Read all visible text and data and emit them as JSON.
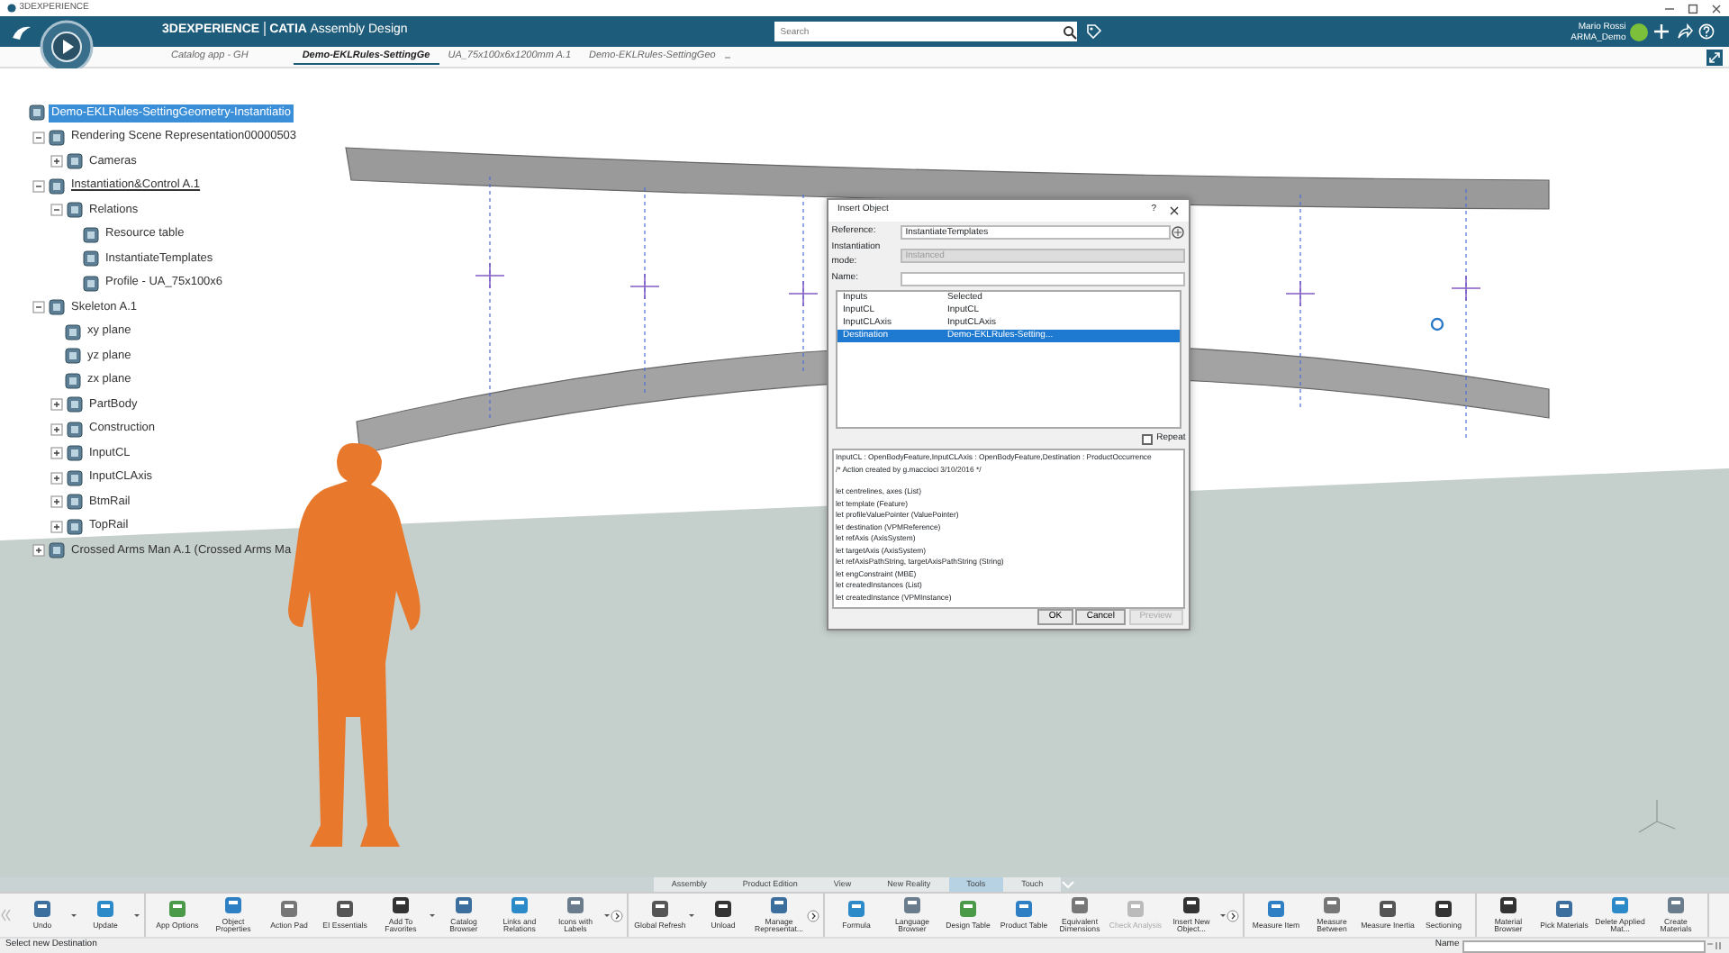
{
  "window": {
    "title": "3DEXPERIENCE"
  },
  "header": {
    "brand": "3DEXPERIENCE",
    "product": "CATIA",
    "app": "Assembly Design",
    "search": {
      "placeholder": "Search"
    },
    "user": {
      "name": "Mario Rossi",
      "workspace": "ARMA_Demo"
    }
  },
  "document_tabs": [
    {
      "label": "Catalog app - GH",
      "selected": false
    },
    {
      "label": "Demo-EKLRules-SettingGe",
      "selected": true
    },
    {
      "label": "UA_75x100x6x1200mm A.1",
      "selected": false
    },
    {
      "label": "Demo-EKLRules-SettingGeo",
      "selected": false
    }
  ],
  "tree": {
    "label": "Demo-EKLRules-SettingGeometry-Instantiatio",
    "selected": true,
    "active": false,
    "children": [
      {
        "label": "Rendering Scene Representation00000503",
        "expanded": true,
        "selected": false,
        "active": false,
        "children": [
          {
            "label": "Cameras",
            "expanded": false,
            "selected": false,
            "active": false
          }
        ]
      },
      {
        "label": "Instantiation&Control A.1",
        "expanded": true,
        "selected": false,
        "active": true,
        "children": [
          {
            "label": "Relations",
            "expanded": true,
            "selected": false,
            "active": false,
            "children": [
              {
                "label": "Resource table",
                "selected": false,
                "active": false
              },
              {
                "label": "InstantiateTemplates",
                "selected": false,
                "active": false
              },
              {
                "label": "Profile - UA_75x100x6",
                "selected": false,
                "active": false
              }
            ]
          }
        ]
      },
      {
        "label": "Skeleton A.1",
        "expanded": true,
        "selected": false,
        "active": false,
        "children": [
          {
            "label": "xy plane",
            "selected": false,
            "active": false
          },
          {
            "label": "yz plane",
            "selected": false,
            "active": false
          },
          {
            "label": "zx plane",
            "selected": false,
            "active": false
          },
          {
            "label": "PartBody",
            "expanded": false,
            "selected": false,
            "active": false
          },
          {
            "label": "Construction",
            "expanded": false,
            "selected": false,
            "active": false
          },
          {
            "label": "InputCL",
            "expanded": false,
            "selected": false,
            "active": false
          },
          {
            "label": "InputCLAxis",
            "expanded": false,
            "selected": false,
            "active": false
          },
          {
            "label": "BtmRail",
            "expanded": false,
            "selected": false,
            "active": false
          },
          {
            "label": "TopRail",
            "expanded": false,
            "selected": false,
            "active": false
          }
        ]
      },
      {
        "label": "Crossed Arms Man A.1 (Crossed Arms Ma",
        "expanded": false,
        "selected": false,
        "active": false
      }
    ]
  },
  "dialog": {
    "title": "Insert Object",
    "help": "?",
    "fields": [
      {
        "label": "Reference:",
        "value": "InstantiateTemplates",
        "disabled": false
      },
      {
        "label": "Instantiation mode:",
        "value": "Instanced",
        "disabled": true
      },
      {
        "label": "Name:",
        "disabled": false
      }
    ],
    "table": {
      "columns": [
        "Inputs",
        "Selected"
      ],
      "rows": [
        {
          "cells": [
            "InputCL",
            "InputCL"
          ],
          "selected": false
        },
        {
          "cells": [
            "InputCLAxis",
            "InputCLAxis"
          ],
          "selected": false
        },
        {
          "cells": [
            "Destination",
            "Demo-EKLRules-Setting..."
          ],
          "selected": true
        }
      ]
    },
    "repeat": {
      "label": "Repeat",
      "checked": false
    },
    "code_header": "InputCL : OpenBodyFeature,InputCLAxis : OpenBodyFeature,Destination : ProductOccurrence",
    "code_lines": [
      "/* Action created by g.maccioci 3/10/2016 */",
      "let centrelines, axes (List)",
      "let template (Feature)",
      "let profileValuePointer (ValuePointer)",
      "let destination (VPMReference)",
      "let refAxis (AxisSystem)",
      "let targetAxis (AxisSystem)",
      "let refAxisPathString, targetAxisPathString (String)",
      "let engConstraint (MBE)",
      "let createdInstances (List)",
      "let createdInstance (VPMInstance)"
    ],
    "buttons": [
      {
        "label": "OK",
        "disabled": false
      },
      {
        "label": "Cancel",
        "disabled": false
      },
      {
        "label": "Preview",
        "disabled": true
      }
    ]
  },
  "section_tabs": [
    {
      "label": "Assembly",
      "selected": false
    },
    {
      "label": "Product Edition",
      "selected": false
    },
    {
      "label": "View",
      "selected": false
    },
    {
      "label": "New Reality",
      "selected": false
    },
    {
      "label": "Tools",
      "selected": true
    },
    {
      "label": "Touch",
      "selected": false
    }
  ],
  "toolbar": [
    {
      "more": false,
      "items": [
        {
          "label": "Undo",
          "dropdown": true,
          "disabled": false
        },
        {
          "label": "Update",
          "dropdown": true,
          "disabled": false
        }
      ]
    },
    {
      "more": true,
      "items": [
        {
          "label": "App Options",
          "dropdown": false,
          "disabled": false
        },
        {
          "label": "Object Properties",
          "dropdown": false,
          "disabled": false
        },
        {
          "label": "Action Pad",
          "dropdown": false,
          "disabled": false
        },
        {
          "label": "EI Essentials",
          "dropdown": false,
          "disabled": false
        },
        {
          "label": "Add To Favorites",
          "dropdown": true,
          "disabled": false
        },
        {
          "label": "Catalog Browser",
          "dropdown": false,
          "disabled": false
        },
        {
          "label": "Links and Relations",
          "dropdown": false,
          "disabled": false
        },
        {
          "label": "Icons with Labels",
          "dropdown": true,
          "disabled": false
        }
      ]
    },
    {
      "more": true,
      "items": [
        {
          "label": "Global Refresh",
          "dropdown": true,
          "disabled": false
        },
        {
          "label": "Unload",
          "dropdown": false,
          "disabled": false
        },
        {
          "label": "Manage Representat...",
          "dropdown": false,
          "disabled": false
        }
      ]
    },
    {
      "more": true,
      "items": [
        {
          "label": "Formula",
          "dropdown": false,
          "disabled": false
        },
        {
          "label": "Language Browser",
          "dropdown": false,
          "disabled": false
        },
        {
          "label": "Design Table",
          "dropdown": false,
          "disabled": false
        },
        {
          "label": "Product Table",
          "dropdown": false,
          "disabled": false
        },
        {
          "label": "Equivalent Dimensions",
          "dropdown": false,
          "disabled": false
        },
        {
          "label": "Check Analysis",
          "dropdown": false,
          "disabled": true
        },
        {
          "label": "Insert New Object...",
          "dropdown": true,
          "disabled": false
        }
      ]
    },
    {
      "more": false,
      "items": [
        {
          "label": "Measure Item",
          "dropdown": false,
          "disabled": false
        },
        {
          "label": "Measure Between",
          "dropdown": false,
          "disabled": false
        },
        {
          "label": "Measure Inertia",
          "dropdown": false,
          "disabled": false
        },
        {
          "label": "Sectioning",
          "dropdown": false,
          "disabled": false
        }
      ]
    },
    {
      "more": false,
      "items": [
        {
          "label": "Material Browser",
          "dropdown": false,
          "disabled": false
        },
        {
          "label": "Pick Materials",
          "dropdown": false,
          "disabled": false
        },
        {
          "label": "Delete Applied Mat...",
          "dropdown": false,
          "disabled": false
        },
        {
          "label": "Create Materials",
          "dropdown": false,
          "disabled": false
        }
      ]
    }
  ],
  "status_bar": {
    "message": "Select new Destination",
    "name_label": "Name"
  }
}
